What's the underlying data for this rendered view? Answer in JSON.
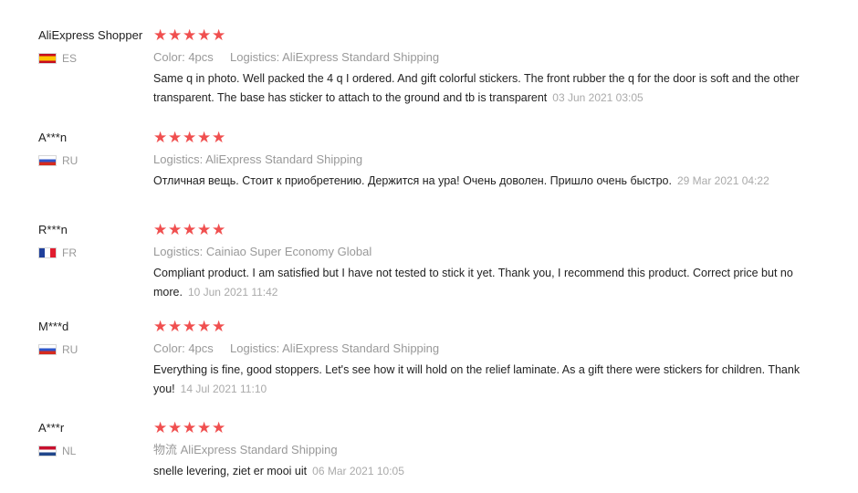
{
  "reviews": [
    {
      "user_name": "AliExpress Shopper",
      "country": "ES",
      "flag": "spain-flag-icon",
      "rating": 5,
      "stars": [
        "★",
        "★",
        "★",
        "★",
        "★"
      ],
      "color_label": "Color:",
      "color_value": "4pcs",
      "logistics_label": "Logistics:",
      "logistics_value": "AliExpress Standard Shipping",
      "feedback": "Same q in photo. Well packed the 4 q I ordered. And gift colorful stickers. The front rubber the q for the door is soft and the other transparent. The base has sticker to attach to the ground and tb is transparent",
      "date": "03 Jun 2021 03:05"
    },
    {
      "user_name": "A***n",
      "country": "RU",
      "flag": "russia-flag-icon",
      "rating": 5,
      "stars": [
        "★",
        "★",
        "★",
        "★",
        "★"
      ],
      "logistics_label": "Logistics:",
      "logistics_value": "AliExpress Standard Shipping",
      "feedback": "Отличная вещь. Стоит к приобретению. Держится на ура! Очень доволен. Пришло очень быстро.",
      "date": "29 Mar 2021 04:22"
    },
    {
      "user_name": "R***n",
      "country": "FR",
      "flag": "france-flag-icon",
      "rating": 5,
      "stars": [
        "★",
        "★",
        "★",
        "★",
        "★"
      ],
      "logistics_label": "Logistics:",
      "logistics_value": "Cainiao Super Economy Global",
      "feedback": "Compliant product. I am satisfied but I have not tested to stick it yet. Thank you, I recommend this product. Correct price but no more.",
      "date": "10 Jun 2021 11:42"
    },
    {
      "user_name": "M***d",
      "country": "RU",
      "flag": "russia-flag-icon",
      "rating": 5,
      "stars": [
        "★",
        "★",
        "★",
        "★",
        "★"
      ],
      "color_label": "Color:",
      "color_value": "4pcs",
      "logistics_label": "Logistics:",
      "logistics_value": "AliExpress Standard Shipping",
      "feedback": "Everything is fine, good stoppers. Let's see how it will hold on the relief laminate. As a gift there were stickers for children. Thank you!",
      "date": "14 Jul 2021 11:10"
    },
    {
      "user_name": "A***r",
      "country": "NL",
      "flag": "netherlands-flag-icon",
      "rating": 5,
      "stars": [
        "★",
        "★",
        "★",
        "★",
        "★"
      ],
      "logistics_label": "物流",
      "logistics_value": "AliExpress Standard Shipping",
      "feedback": "snelle levering, ziet er mooi uit",
      "date": "06 Mar 2021 10:05"
    }
  ]
}
